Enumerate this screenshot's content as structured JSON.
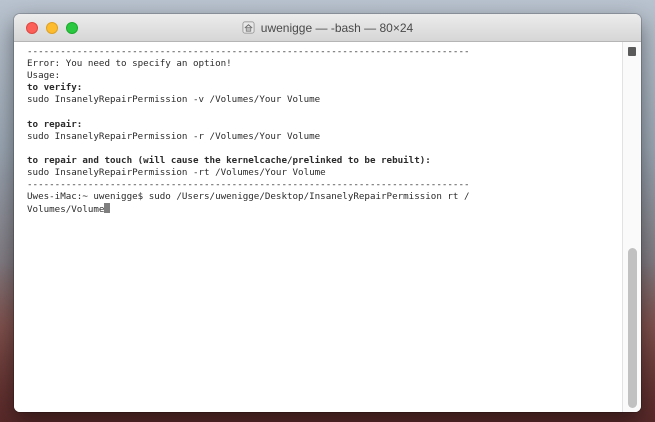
{
  "window": {
    "title": "uwenigge — -bash — 80×24"
  },
  "terminal": {
    "lines": [
      {
        "text": "--------------------------------------------------------------------------------",
        "bold": false
      },
      {
        "text": "Error: You need to specify an option!",
        "bold": false
      },
      {
        "text": "Usage:",
        "bold": false
      },
      {
        "text": "to verify:",
        "bold": true
      },
      {
        "text": "sudo InsanelyRepairPermission -v /Volumes/Your Volume",
        "bold": false
      },
      {
        "text": "",
        "bold": false
      },
      {
        "text": "to repair:",
        "bold": true
      },
      {
        "text": "sudo InsanelyRepairPermission -r /Volumes/Your Volume",
        "bold": false
      },
      {
        "text": "",
        "bold": false
      },
      {
        "text": "to repair and touch (will cause the kernelcache/prelinked to be rebuilt):",
        "bold": true
      },
      {
        "text": "sudo InsanelyRepairPermission -rt /Volumes/Your Volume",
        "bold": false
      },
      {
        "text": "--------------------------------------------------------------------------------",
        "bold": false
      },
      {
        "text": "Uwes-iMac:~ uwenigge$ sudo /Users/uwenigge/Desktop/InsanelyRepairPermission rt /",
        "bold": false
      }
    ],
    "last_line": "Volumes/Volume"
  },
  "colors": {
    "close": "#fc5f57",
    "minimize": "#fdbc2e",
    "maximize": "#29c840"
  },
  "icons": {
    "title": "home-icon",
    "scroll": "scroll-marker-icon"
  }
}
